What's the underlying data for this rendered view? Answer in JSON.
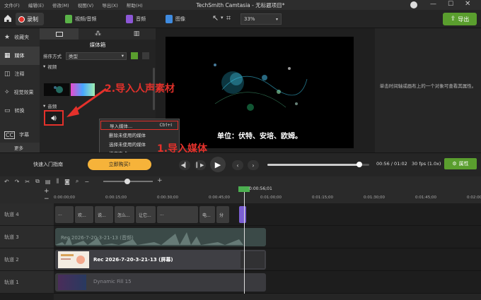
{
  "app": {
    "window_title": "TechSmith Camtasia - 无标题项目*"
  },
  "menu": [
    "文件(F)",
    "编辑(E)",
    "修改(M)",
    "视图(V)",
    "导出(X)",
    "帮助(H)"
  ],
  "toolbar": {
    "record_label": "录制",
    "create_tabs": [
      "视频/音频",
      "音频",
      "图像"
    ],
    "zoom_value": "33%",
    "export_label": "导出"
  },
  "left_nav": [
    {
      "icon": "star-icon",
      "label": "收藏夹"
    },
    {
      "icon": "media-icon",
      "label": "媒体"
    },
    {
      "icon": "annotation-icon",
      "label": "注释"
    },
    {
      "icon": "effects-icon",
      "label": "视觉效果"
    },
    {
      "icon": "transition-icon",
      "label": "转换"
    },
    {
      "icon": "caption-icon",
      "label": "字幕"
    }
  ],
  "more_label": "更多",
  "media_bin": {
    "title": "媒体箱",
    "sort_label": "排序方式",
    "sort_value": "类型",
    "section_video": "视频",
    "section_audio": "音频"
  },
  "context_menu": {
    "items": [
      {
        "label": "导入媒体...",
        "shortcut": "Ctrl+I",
        "highlight": true
      },
      {
        "label": "删除未使用的媒体",
        "shortcut": ""
      },
      {
        "label": "选择未使用的媒体",
        "shortcut": ""
      },
      {
        "label": "排序方式",
        "shortcut": ""
      }
    ]
  },
  "annotations": {
    "step1": "1.导入媒体",
    "step2": "2.导入人声素材"
  },
  "preview": {
    "caption": "单位：伏特、安培、欧姆。"
  },
  "properties_hint": "单击时间轴或画布上的一个对象可查看其属性。",
  "controls": {
    "guide_label": "快速入门指南",
    "buy_label": "立即购买!",
    "time_display": "00:56 / 01:02",
    "fps_display": "30 fps (1.0x)",
    "properties_label": "属性",
    "progress": 0.9
  },
  "timeline": {
    "playhead_time": "0:00:56;01",
    "ruler_ticks": [
      "0:00:00;00",
      "0:00:15;00",
      "0:00:30;00",
      "0:00:45;00",
      "0:01:00;00",
      "0:01:15;00",
      "0:01:30;00",
      "0:01:45;00",
      "0:02:00"
    ],
    "tracks": [
      {
        "label": "轨道 4",
        "clip_text": [
          "...",
          "欢...",
          "说...",
          "怎么...",
          "让它...",
          "...",
          "电...",
          "分"
        ]
      },
      {
        "label": "轨道 3",
        "clip_text": [
          "Rec 2026-7-20-3-21-13 (音频)"
        ]
      },
      {
        "label": "轨道 2",
        "clip_text": [
          "Rec 2026-7-20-3-21-13 (屏幕)"
        ]
      },
      {
        "label": "轨道 1",
        "clip_text": [
          "Dynamic Fill 15"
        ]
      }
    ]
  },
  "colors": {
    "accent_green": "#5a9e2e",
    "record_red": "#e4312b",
    "annotation_red": "#e4312b",
    "buy_orange": "#f6b33a",
    "playhead_green": "#4caf50"
  }
}
